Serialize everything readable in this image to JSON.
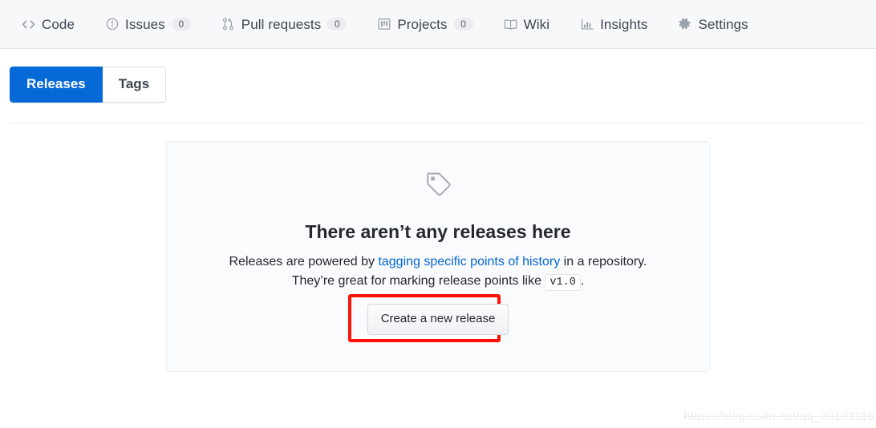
{
  "repo_nav": {
    "items": [
      {
        "label": "Code",
        "icon": "code-icon",
        "count": null,
        "selected": false
      },
      {
        "label": "Issues",
        "icon": "issue-opened-icon",
        "count": "0",
        "selected": false
      },
      {
        "label": "Pull requests",
        "icon": "git-pull-request-icon",
        "count": "0",
        "selected": false
      },
      {
        "label": "Projects",
        "icon": "project-board-icon",
        "count": "0",
        "selected": false
      },
      {
        "label": "Wiki",
        "icon": "book-icon",
        "count": null,
        "selected": false
      },
      {
        "label": "Insights",
        "icon": "graph-icon",
        "count": null,
        "selected": false
      },
      {
        "label": "Settings",
        "icon": "gear-icon",
        "count": null,
        "selected": false
      }
    ]
  },
  "subnav": {
    "tabs": [
      {
        "label": "Releases",
        "selected": true
      },
      {
        "label": "Tags",
        "selected": false
      }
    ]
  },
  "blankslate": {
    "icon": "tag-icon",
    "title": "There aren’t any releases here",
    "description_prefix": "Releases are powered by ",
    "description_link": "tagging specific points of history",
    "description_suffix": " in a repository.",
    "second_line_prefix": "They’re great for marking release points like ",
    "second_line_code": "v1.0",
    "second_line_suffix": ".",
    "cta_label": "Create a new release"
  },
  "annotation": {
    "color": "#fc1107"
  },
  "watermark": {
    "text": "https://blog.csdn.net/qq_39191116"
  },
  "colors": {
    "accent_blue": "#0669d8",
    "link_blue": "#0366d6",
    "nav_bg": "#f6f8fa",
    "panel_bg": "#fafbfc",
    "annotation_red": "#fc1107"
  }
}
